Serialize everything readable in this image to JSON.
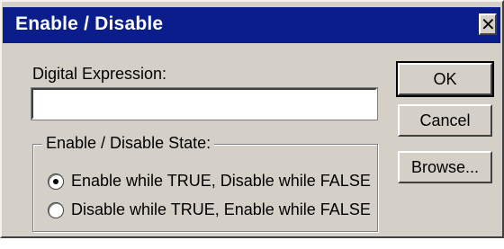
{
  "window": {
    "title": "Enable / Disable",
    "close_glyph": "✕"
  },
  "expression": {
    "label": "Digital Expression:",
    "value": ""
  },
  "state_group": {
    "label": "Enable / Disable State:",
    "options": [
      {
        "label": "Enable while TRUE, Disable while FALSE",
        "checked": true
      },
      {
        "label": "Disable while TRUE, Enable while FALSE",
        "checked": false
      }
    ]
  },
  "buttons": {
    "ok": "OK",
    "cancel": "Cancel",
    "browse": "Browse..."
  },
  "colors": {
    "titlebar": "#0a1d8a",
    "face": "#d4d0c8"
  },
  "icons": {
    "close": "close-icon"
  }
}
